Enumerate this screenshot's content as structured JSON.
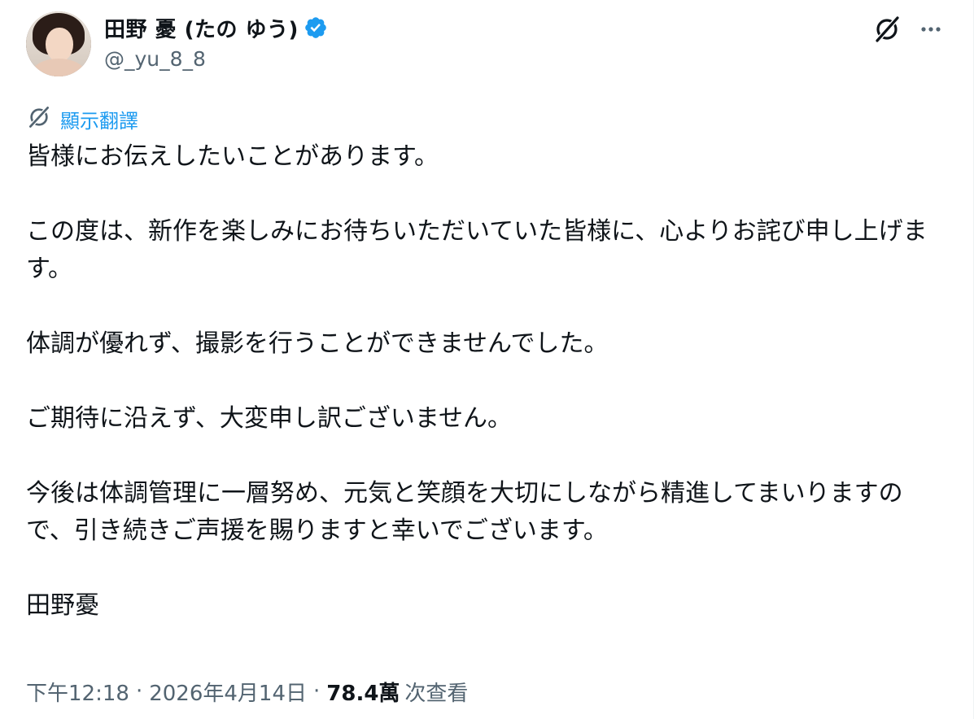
{
  "author": {
    "display_name": "田野 憂 (たの ゆう)",
    "handle": "@_yu_8_8",
    "verified": true,
    "avatar_icon": "profile-photo"
  },
  "header_actions": {
    "grok_icon": "grok-icon",
    "more_icon": "more-icon"
  },
  "translate": {
    "label": "顯示翻譯",
    "icon": "grok-translate-icon"
  },
  "tweet": {
    "paragraphs": [
      "皆様にお伝えしたいことがあります。",
      "この度は、新作を楽しみにお待ちいただいていた皆様に、心よりお詫び申し上げます。",
      "体調が優れず、撮影を行うことができませんでした。",
      "ご期待に沿えず、大変申し訳ございません。",
      "今後は体調管理に一層努め、元気と笑顔を大切にしながら精進してまいりますので、引き続きご声援を賜りますと幸いでございます。",
      "田野憂"
    ]
  },
  "meta": {
    "time": "下午12:18",
    "date": "2026年4月14日",
    "views_count": "78.4萬",
    "views_label": "次查看",
    "separator": "·"
  },
  "colors": {
    "text": "#0f1419",
    "secondary": "#536471",
    "accent": "#1d9bf0"
  }
}
